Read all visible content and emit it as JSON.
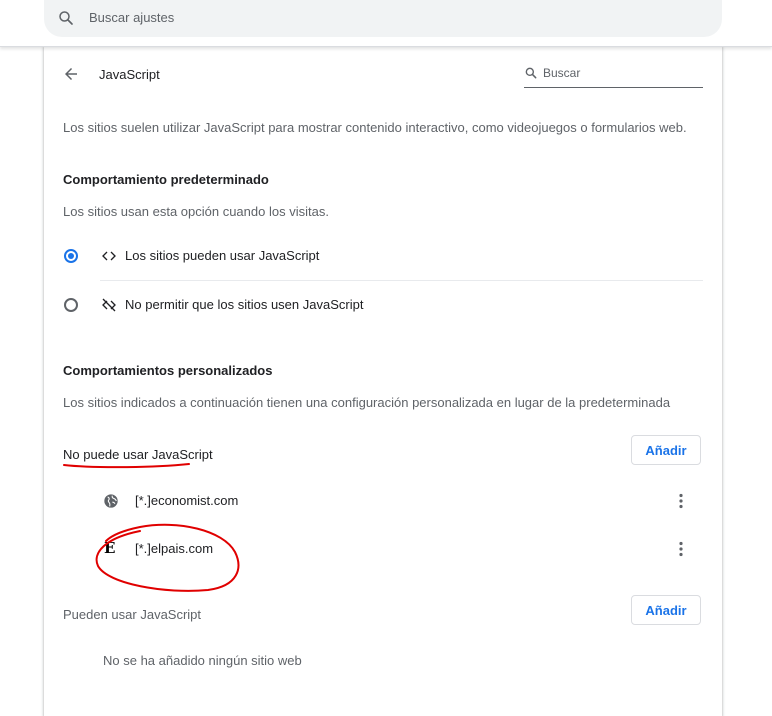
{
  "search": {
    "placeholder": "Buscar ajustes"
  },
  "header": {
    "title": "JavaScript",
    "search_label": "Buscar"
  },
  "description": "Los sitios suelen utilizar JavaScript para mostrar contenido interactivo, como videojuegos o formularios web.",
  "default_behavior": {
    "heading": "Comportamiento predeterminado",
    "subtitle": "Los sitios usan esta opción cuando los visitas.",
    "options": [
      {
        "label": "Los sitios pueden usar JavaScript",
        "icon": "code-icon",
        "selected": true
      },
      {
        "label": "No permitir que los sitios usen JavaScript",
        "icon": "code-off-icon",
        "selected": false
      }
    ]
  },
  "custom_behavior": {
    "heading": "Comportamientos personalizados",
    "subtitle": "Los sitios indicados a continuación tienen una configuración personalizada en lugar de la predeterminada",
    "blocked": {
      "title": "No puede usar JavaScript",
      "add_label": "Añadir",
      "sites": [
        {
          "name": "[*.]economist.com",
          "icon": "globe-icon"
        },
        {
          "name": "[*.]elpais.com",
          "icon": "elpais-favicon",
          "favicon_letter": "E"
        }
      ]
    },
    "allowed": {
      "title": "Pueden usar JavaScript",
      "add_label": "Añadir",
      "empty_text": "No se ha añadido ningún sitio web"
    }
  },
  "colors": {
    "accent": "#1a73e8",
    "annotation": "#e00000"
  }
}
